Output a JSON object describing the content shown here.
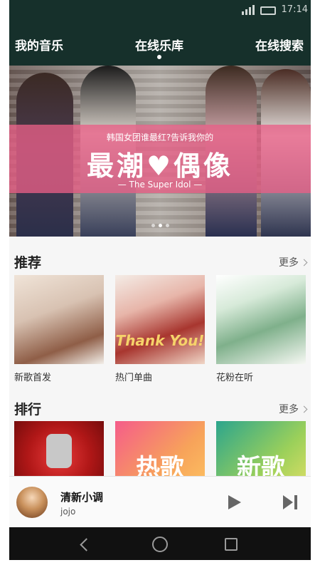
{
  "status_bar": {
    "time": "17:14",
    "icons": [
      "signal-icon",
      "battery-icon"
    ]
  },
  "top_nav": {
    "tabs": [
      {
        "label": "我的音乐",
        "active": false
      },
      {
        "label": "在线乐库",
        "active": true
      },
      {
        "label": "在线搜索",
        "active": false
      }
    ]
  },
  "banner": {
    "subtitle": "韩国女团谁最红?告诉我你的",
    "title": "最潮♥偶像",
    "tagline": "— The Super Idol —",
    "slide_count": 3,
    "active_slide": 1,
    "accent": "#e85f87"
  },
  "recommend": {
    "title": "推荐",
    "more_label": "更多",
    "items": [
      {
        "label": "新歌首发"
      },
      {
        "label": "热门单曲",
        "image_text": "Thank You!"
      },
      {
        "label": "花粉在听"
      }
    ]
  },
  "ranking": {
    "title": "排行",
    "more_label": "更多",
    "items": [
      {
        "label": "",
        "image_text": ""
      },
      {
        "label": "",
        "image_text": "热歌"
      },
      {
        "label": "",
        "image_text": "新歌"
      }
    ]
  },
  "player": {
    "song": "清新小调",
    "artist": "jojo"
  },
  "colors": {
    "header_bg": "#16302b",
    "page_bg": "#f6f6f6"
  }
}
